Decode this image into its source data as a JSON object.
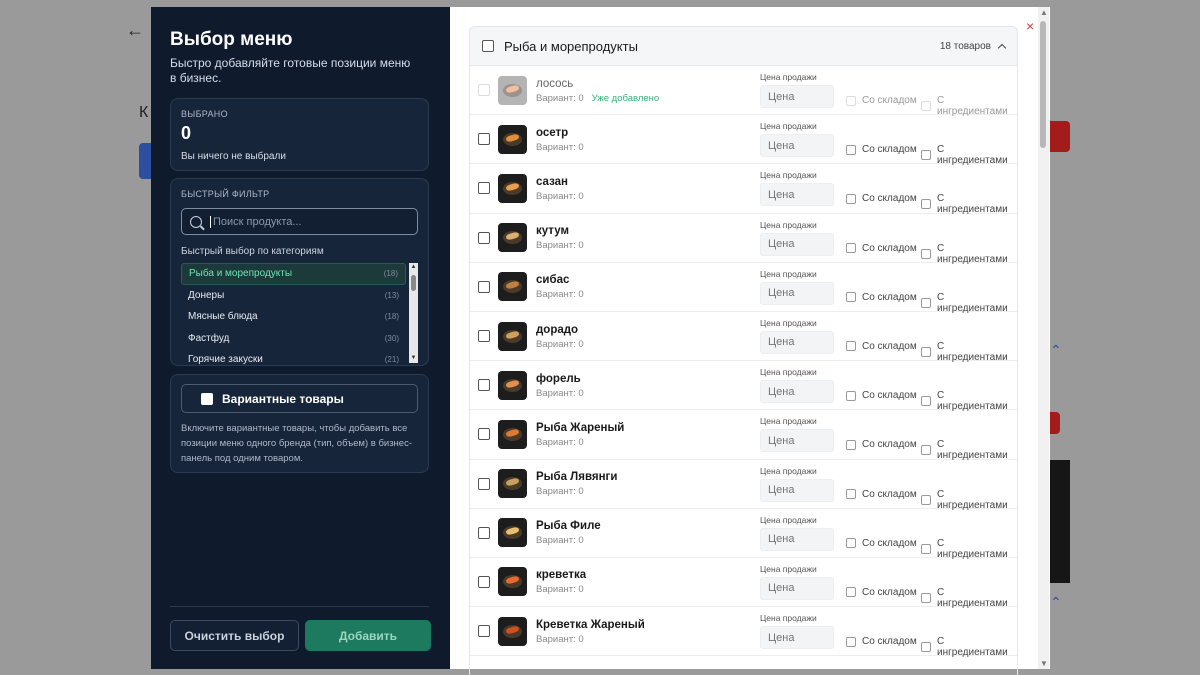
{
  "background": {
    "back_arrow": "←",
    "letter_k": "К"
  },
  "left": {
    "title": "Выбор меню",
    "subtitle": "Быстро добавляйте готовые позиции меню в бизнес.",
    "selected_label": "ВЫБРАНО",
    "selected_count": "0",
    "selected_empty": "Вы ничего не выбрали",
    "filter_label": "БЫСТРЫЙ ФИЛЬТР",
    "search_placeholder": "Поиск продукта...",
    "quick_label": "Быстрый выбор по категориям",
    "categories": [
      {
        "label": "Рыба и морепродукты",
        "count": "(18)"
      },
      {
        "label": "Донеры",
        "count": "(13)"
      },
      {
        "label": "Мясные блюда",
        "count": "(18)"
      },
      {
        "label": "Фастфуд",
        "count": "(30)"
      },
      {
        "label": "Горячие закуски",
        "count": "(21)"
      }
    ],
    "variant_label": "Вариантные товары",
    "variant_desc": "Включите вариантные товары, чтобы добавить все позиции меню одного бренда (тип, объем) в бизнес-панель под одним товаром.",
    "clear_button": "Очистить выбор",
    "add_button": "Добавить"
  },
  "right": {
    "close": "×",
    "category_title": "Рыба и морепродукты",
    "category_count": "18 товаров",
    "price_label": "Цена продажи",
    "price_placeholder": "Цена",
    "opt_stock": "Со складом",
    "opt_ingredients": "С ингредиентами",
    "variant_prefix": "Вариант: 0",
    "already_added": "Уже добавлено",
    "items": [
      {
        "name": "лосось",
        "added": true,
        "color": "#e88a5a"
      },
      {
        "name": "осетр",
        "added": false,
        "color": "#e0903a"
      },
      {
        "name": "сазан",
        "added": false,
        "color": "#e8a050"
      },
      {
        "name": "кутум",
        "added": false,
        "color": "#d8b070"
      },
      {
        "name": "сибас",
        "added": false,
        "color": "#c08040"
      },
      {
        "name": "дорадо",
        "added": false,
        "color": "#d0a060"
      },
      {
        "name": "форель",
        "added": false,
        "color": "#e09050"
      },
      {
        "name": "Рыба Жареный",
        "added": false,
        "color": "#e07a30"
      },
      {
        "name": "Рыба Лявянги",
        "added": false,
        "color": "#c8a060"
      },
      {
        "name": "Рыба Филе",
        "added": false,
        "color": "#e8c070"
      },
      {
        "name": "креветка",
        "added": false,
        "color": "#e86a30"
      },
      {
        "name": "Креветка Жареный",
        "added": false,
        "color": "#d05020"
      }
    ]
  }
}
